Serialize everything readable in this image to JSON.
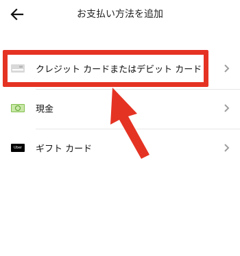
{
  "header": {
    "title": "お支払い方法を追加",
    "back_icon": "arrow-left-icon"
  },
  "rows": [
    {
      "label": "クレジット カードまたはデビット カード",
      "icon": "credit-card-icon"
    },
    {
      "label": "現金",
      "icon": "cash-icon"
    },
    {
      "label": "ギフト カード",
      "icon": "uber-gift-card-icon",
      "icon_text": "Uber"
    }
  ],
  "colors": {
    "highlight": "#e53323",
    "chevron": "#9e9e9e",
    "divider": "#e6e6e6"
  }
}
